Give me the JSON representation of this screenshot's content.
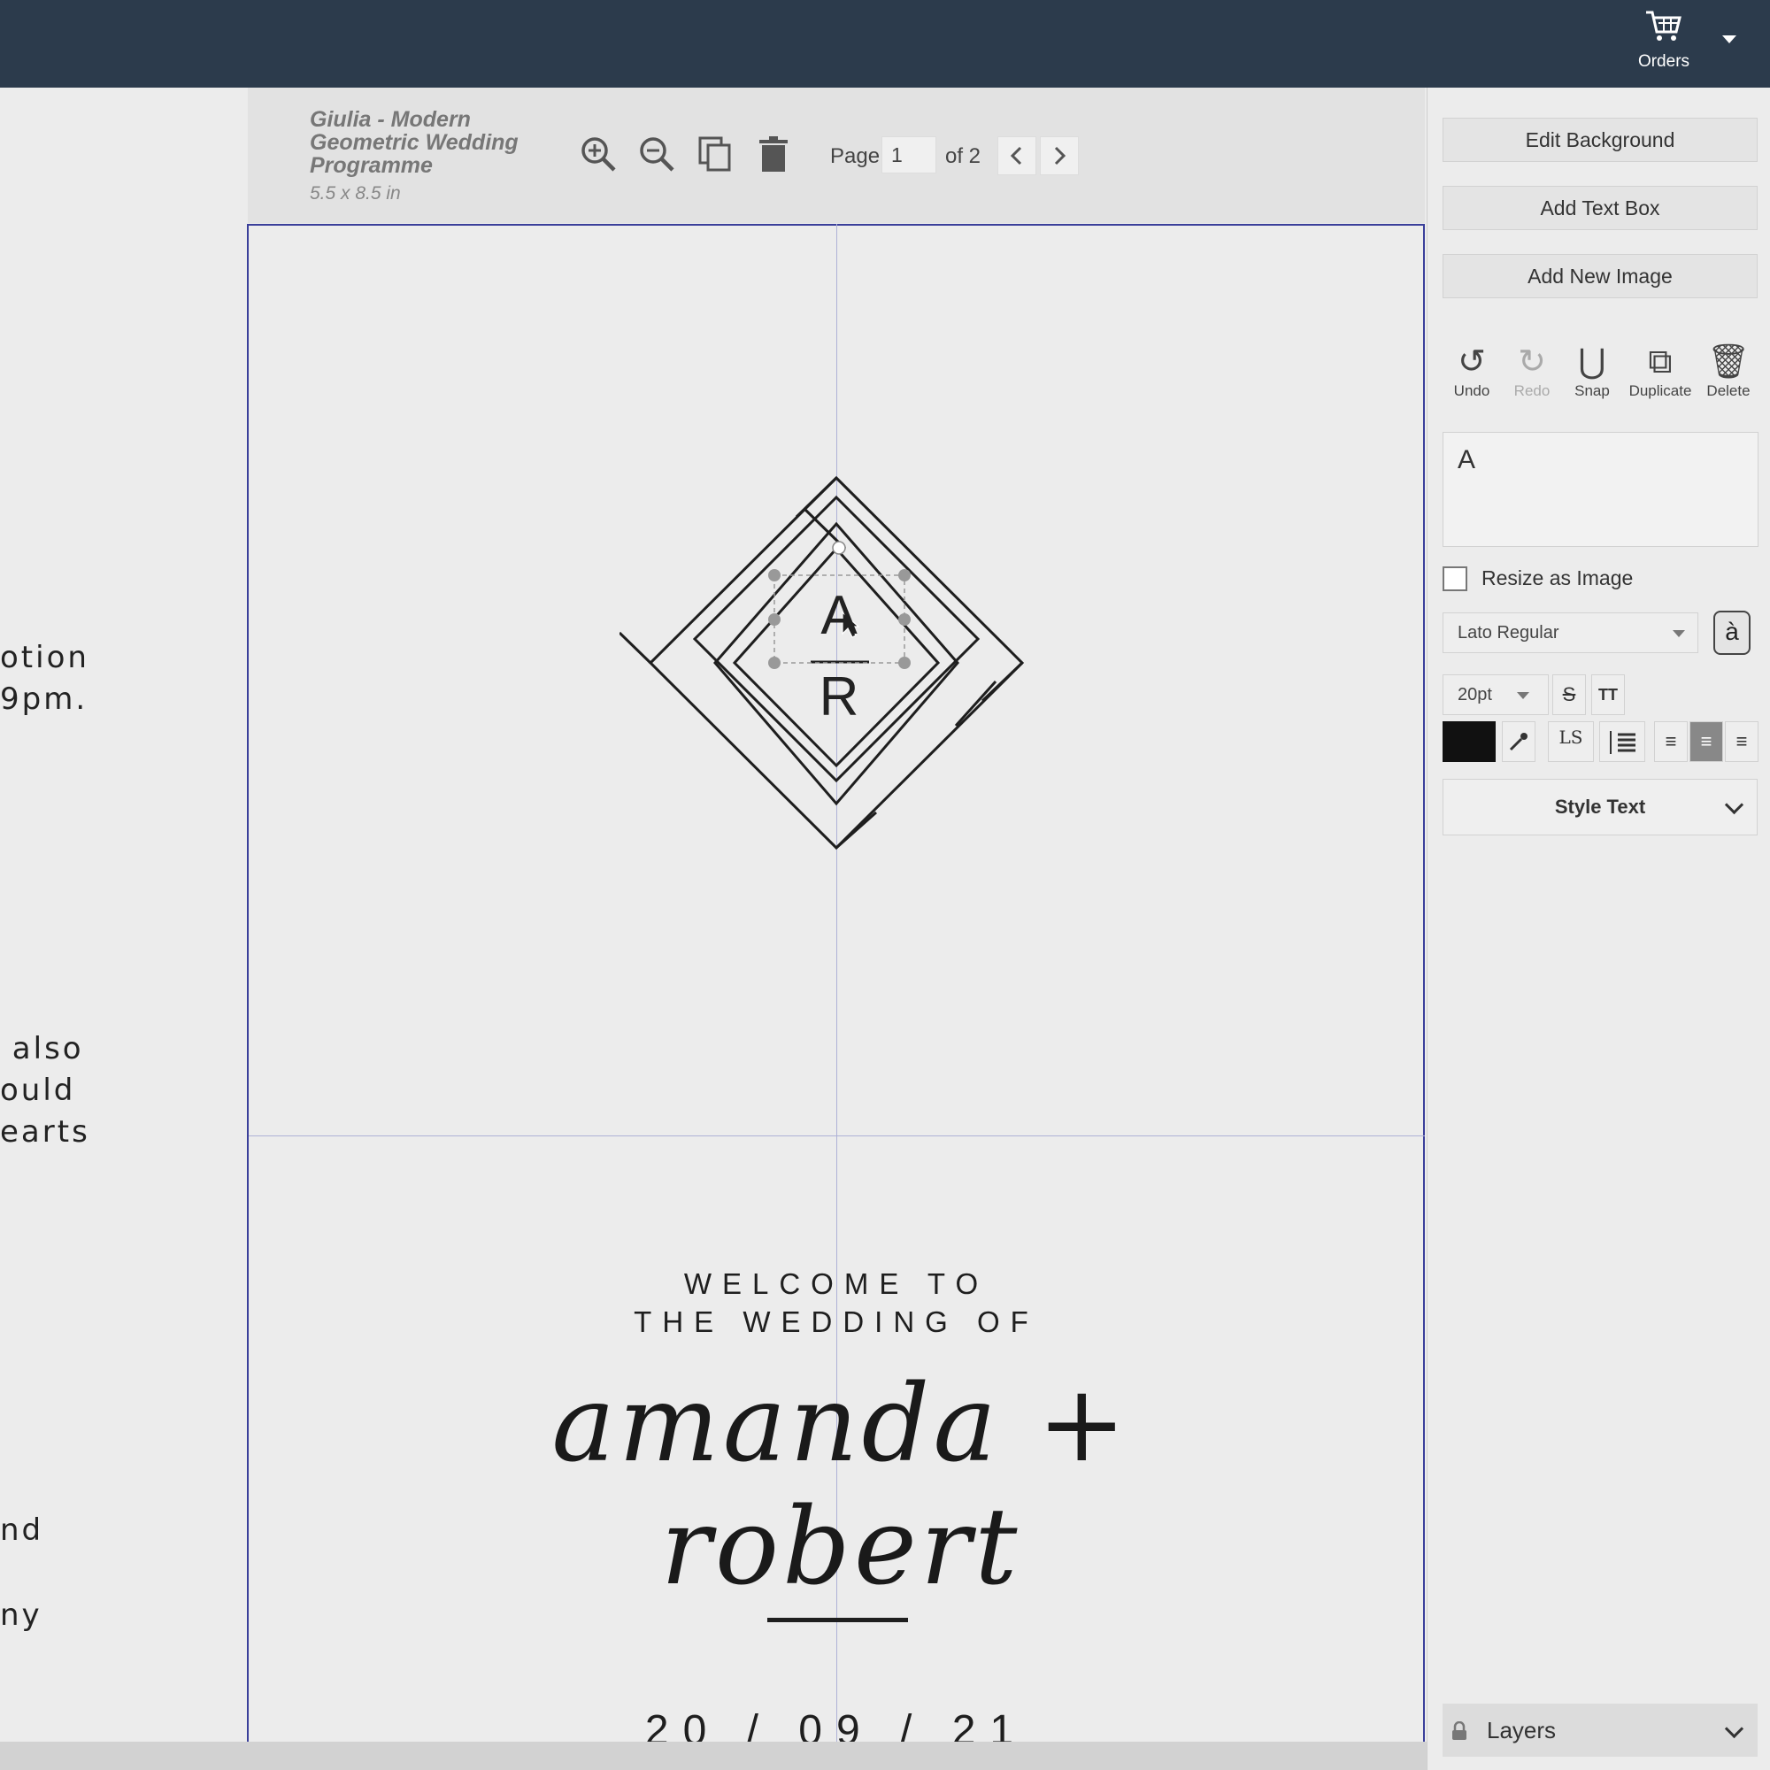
{
  "header": {
    "orders_label": "Orders"
  },
  "left_fragments": [
    {
      "text": "otion",
      "top": 0
    },
    {
      "text": "9pm.",
      "top": 0
    },
    {
      "text": " also",
      "top": 0
    },
    {
      "text": "ould",
      "top": 0
    },
    {
      "text": "earts",
      "top": 0
    },
    {
      "text": "nd",
      "top": 0
    },
    {
      "text": "ny",
      "top": 0
    }
  ],
  "document": {
    "title": "Giulia - Modern Geometric Wedding Programme",
    "size": "5.5 x 8.5 in",
    "page_label": "Page",
    "page_value": "1",
    "page_of": "of 2"
  },
  "canvas": {
    "monogram_top": "A",
    "monogram_bottom": "R",
    "welcome_line1": "WELCOME TO",
    "welcome_line2": "THE WEDDING OF",
    "names": "amanda + robert",
    "date": "20 / 09 / 21"
  },
  "panel": {
    "edit_background": "Edit Background",
    "add_text_box": "Add Text Box",
    "add_new_image": "Add New Image",
    "tools": [
      "Undo",
      "Redo",
      "Snap",
      "Duplicate",
      "Delete"
    ],
    "text_value": "A",
    "resize_label": "Resize as Image",
    "font": "Lato Regular",
    "font_size": "20pt",
    "style_text": "Style Text",
    "layers": "Layers"
  },
  "colors": {
    "topbar": "#2c3b4c",
    "text_color": "#111111",
    "guide": "#aeb1d6",
    "canvas_border": "#3a3f9a"
  }
}
